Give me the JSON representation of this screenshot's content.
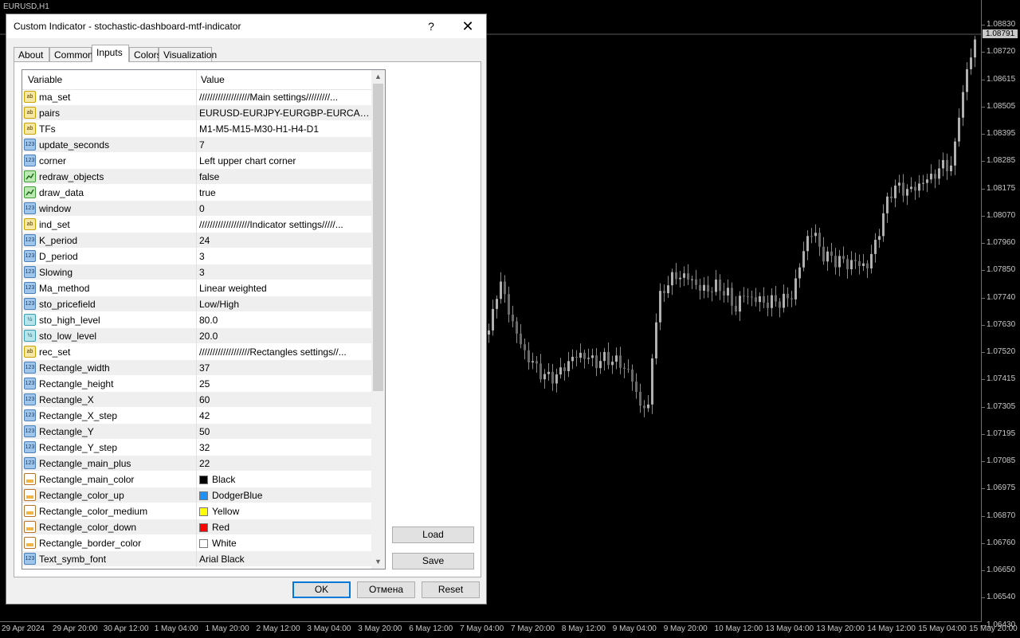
{
  "chart": {
    "symbol": "EURUSD,H1",
    "current_price": "1.08791",
    "price_ticks": [
      "1.08830",
      "1.08720",
      "1.08615",
      "1.08505",
      "1.08395",
      "1.08285",
      "1.08175",
      "1.08070",
      "1.07960",
      "1.07850",
      "1.07740",
      "1.07630",
      "1.07520",
      "1.07415",
      "1.07305",
      "1.07195",
      "1.07085",
      "1.06975",
      "1.06870",
      "1.06760",
      "1.06650",
      "1.06540",
      "1.06430"
    ],
    "time_ticks": [
      "29 Apr 2024",
      "29 Apr 20:00",
      "30 Apr 12:00",
      "1 May 04:00",
      "1 May 20:00",
      "2 May 12:00",
      "3 May 04:00",
      "3 May 20:00",
      "6 May 12:00",
      "7 May 04:00",
      "7 May 20:00",
      "8 May 12:00",
      "9 May 04:00",
      "9 May 20:00",
      "10 May 12:00",
      "13 May 04:00",
      "13 May 20:00",
      "14 May 12:00",
      "15 May 04:00",
      "15 May 20:00"
    ]
  },
  "dialog": {
    "title": "Custom Indicator - stochastic-dashboard-mtf-indicator",
    "help": "?",
    "close": "✕",
    "tabs": [
      "About",
      "Common",
      "Inputs",
      "Colors",
      "Visualization"
    ],
    "active_tab": "Inputs",
    "columns": {
      "variable": "Variable",
      "value": "Value"
    },
    "rows": [
      {
        "type": "str",
        "name": "ma_set",
        "value": "///////////////////Main settings/////////..."
      },
      {
        "type": "str",
        "name": "pairs",
        "value": "EURUSD-EURJPY-EURGBP-EURCAD-E..."
      },
      {
        "type": "str",
        "name": "TFs",
        "value": "M1-M5-M15-M30-H1-H4-D1"
      },
      {
        "type": "int",
        "name": "update_seconds",
        "value": "7"
      },
      {
        "type": "int",
        "name": "corner",
        "value": "Left upper chart corner"
      },
      {
        "type": "bool",
        "name": "redraw_objects",
        "value": "false"
      },
      {
        "type": "bool",
        "name": "draw_data",
        "value": "true"
      },
      {
        "type": "int",
        "name": "window",
        "value": "0"
      },
      {
        "type": "str",
        "name": "ind_set",
        "value": "///////////////////Indicator settings/////..."
      },
      {
        "type": "int",
        "name": "K_period",
        "value": "24"
      },
      {
        "type": "int",
        "name": "D_period",
        "value": "3"
      },
      {
        "type": "int",
        "name": "Slowing",
        "value": "3"
      },
      {
        "type": "int",
        "name": "Ma_method",
        "value": "Linear weighted"
      },
      {
        "type": "int",
        "name": "sto_pricefield",
        "value": "Low/High"
      },
      {
        "type": "dbl",
        "name": "sto_high_level",
        "value": "80.0"
      },
      {
        "type": "dbl",
        "name": "sto_low_level",
        "value": "20.0"
      },
      {
        "type": "str",
        "name": "rec_set",
        "value": "///////////////////Rectangles settings//..."
      },
      {
        "type": "int",
        "name": "Rectangle_width",
        "value": "37"
      },
      {
        "type": "int",
        "name": "Rectangle_height",
        "value": "25"
      },
      {
        "type": "int",
        "name": "Rectangle_X",
        "value": "60"
      },
      {
        "type": "int",
        "name": "Rectangle_X_step",
        "value": "42"
      },
      {
        "type": "int",
        "name": "Rectangle_Y",
        "value": "50"
      },
      {
        "type": "int",
        "name": "Rectangle_Y_step",
        "value": "32"
      },
      {
        "type": "int",
        "name": "Rectangle_main_plus",
        "value": "22"
      },
      {
        "type": "color",
        "name": "Rectangle_main_color",
        "value": "Black",
        "swatch": "#000000"
      },
      {
        "type": "color",
        "name": "Rectangle_color_up",
        "value": "DodgerBlue",
        "swatch": "#1e90ff"
      },
      {
        "type": "color",
        "name": "Rectangle_color_medium",
        "value": "Yellow",
        "swatch": "#ffff00"
      },
      {
        "type": "color",
        "name": "Rectangle_color_down",
        "value": "Red",
        "swatch": "#ff0000"
      },
      {
        "type": "color",
        "name": "Rectangle_border_color",
        "value": "White",
        "swatch": "#ffffff"
      },
      {
        "type": "int",
        "name": "Text_symb_font",
        "value": "Arial Black"
      }
    ],
    "icon_text": {
      "str": "ab",
      "int": "123",
      "bool": "",
      "dbl": "½",
      "color": ""
    },
    "buttons": {
      "load": "Load",
      "save": "Save",
      "ok": "OK",
      "cancel": "Отмена",
      "reset": "Reset"
    }
  }
}
